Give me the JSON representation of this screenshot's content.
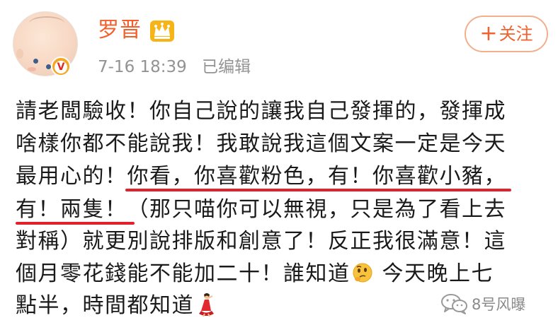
{
  "header": {
    "username": "罗晋",
    "timestamp": "7-16 18:39",
    "edited_label": "已编辑",
    "follow_label": "关注",
    "follow_plus": "+",
    "verified_badge": "V",
    "crown_icon": "crown-icon",
    "accent_color": "#f2612d"
  },
  "post": {
    "lines": [
      "請老闆驗收！你自己說的讓我自己發揮的，發揮成",
      "啥樣你都不能說我！我敢說我這個文案一定是今天",
      "最用心的！你看，你喜歡粉色，有！你喜歡小豬，",
      "有！兩隻！（那只喵你可以無視，只是為了看上去",
      "對稱）就更別說排版和創意了！反正我很滿意！這",
      "個月零花錢能不能加二十！誰知道",
      "點半，時間都知道"
    ],
    "line6_tail": "今天晚上七",
    "emojis": [
      "thinking-face-emoji",
      "dancer-emoji"
    ],
    "highlight_color": "#e3212d"
  },
  "watermark": {
    "text": "8号风曝",
    "icon": "wechat-icon"
  }
}
